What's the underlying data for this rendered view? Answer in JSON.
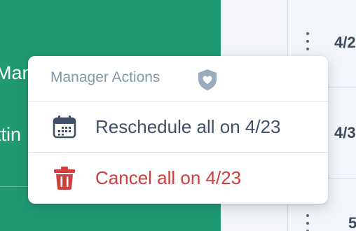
{
  "sidebar": {
    "items": [
      {
        "label": "Man"
      },
      {
        "label": "ttin"
      }
    ]
  },
  "schedule": {
    "rows": [
      {
        "date": "4/2"
      },
      {
        "date": "4/3"
      },
      {
        "date": "5"
      }
    ]
  },
  "menu": {
    "title": "Manager Actions",
    "title_icon": "shield-heart-icon",
    "items": [
      {
        "label": "Reschedule all on 4/23",
        "icon": "calendar-icon",
        "color": "#3f5068"
      },
      {
        "label": "Cancel all on 4/23",
        "icon": "trash-icon",
        "color": "#cf3d3d"
      }
    ]
  },
  "colors": {
    "sidebar_bg": "#1f9a72",
    "accent_danger": "#cf3d3d",
    "text_primary": "#3f5068",
    "text_muted": "#8797a8"
  }
}
